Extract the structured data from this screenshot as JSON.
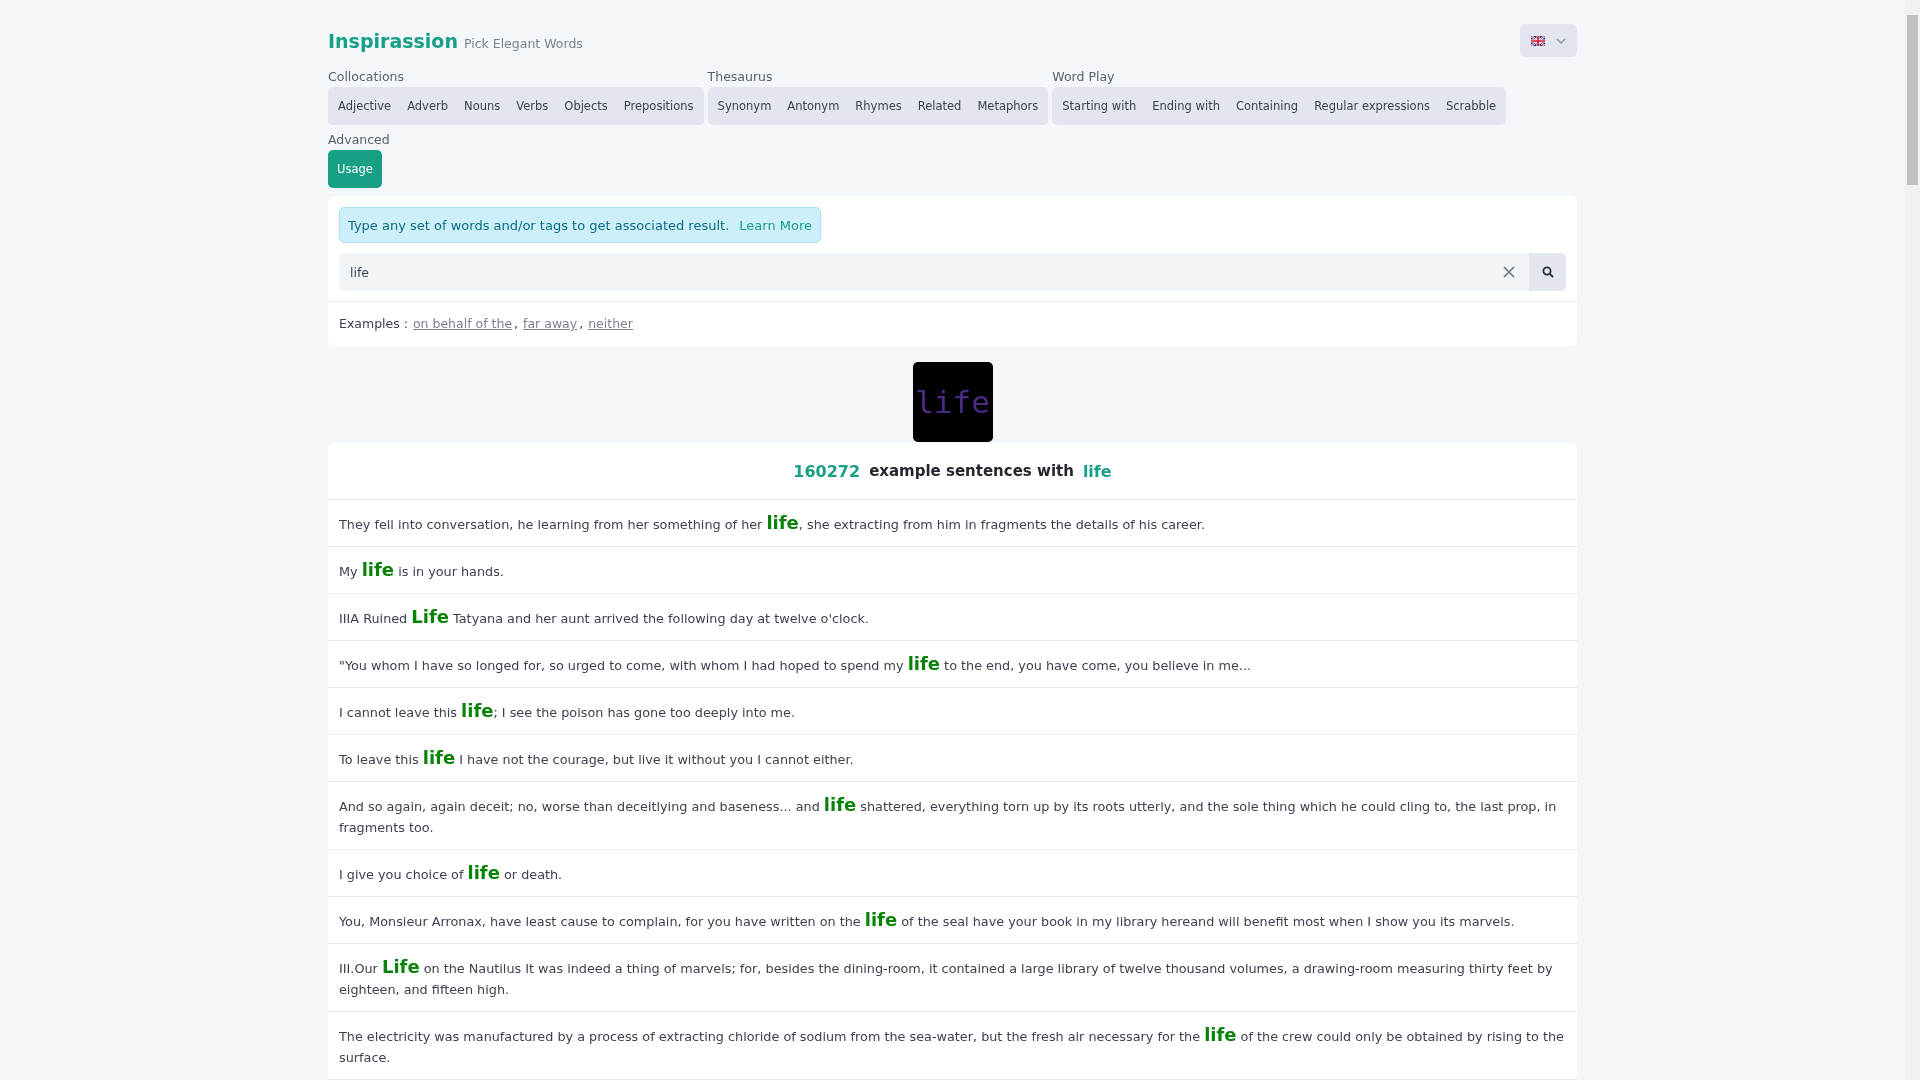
{
  "brand": {
    "name": "Inspirassion",
    "tagline": "Pick Elegant Words"
  },
  "language_button": {
    "kind": "flag"
  },
  "tab_groups": [
    {
      "label": "Collocations",
      "tabs": [
        {
          "label": "Adjective",
          "selected": false
        },
        {
          "label": "Adverb",
          "selected": false
        },
        {
          "label": "Nouns",
          "selected": false
        },
        {
          "label": "Verbs",
          "selected": false
        },
        {
          "label": "Objects",
          "selected": false
        },
        {
          "label": "Prepositions",
          "selected": false
        }
      ]
    },
    {
      "label": "Thesaurus",
      "tabs": [
        {
          "label": "Synonym",
          "selected": false
        },
        {
          "label": "Antonym",
          "selected": false
        },
        {
          "label": "Rhymes",
          "selected": false
        },
        {
          "label": "Related",
          "selected": false
        },
        {
          "label": "Metaphors",
          "selected": false
        }
      ]
    },
    {
      "label": "Word Play",
      "tabs": [
        {
          "label": "Starting with",
          "selected": false
        },
        {
          "label": "Ending with",
          "selected": false
        },
        {
          "label": "Containing",
          "selected": false
        },
        {
          "label": "Regular expressions",
          "selected": false
        },
        {
          "label": "Scrabble",
          "selected": false
        }
      ]
    },
    {
      "label": "Advanced",
      "tabs": [
        {
          "label": "Usage",
          "selected": true
        }
      ]
    }
  ],
  "info": {
    "text": "Type any set of words and/or tags to get associated result.",
    "link": "Learn More"
  },
  "search": {
    "value": "life"
  },
  "examples": {
    "label": "Examples :",
    "separator": ",",
    "links": [
      "on behalf of the",
      "far away",
      "neither"
    ]
  },
  "word_image": {
    "text": "life"
  },
  "results": {
    "count": "160272",
    "text": "example sentences with",
    "word": "life",
    "sentences": [
      "They fell into conversation, he learning from her something of her **life**, she extracting from him in fragments the details of his career.",
      "My **life** is in your hands.",
      "IIIA Ruined **Life** Tatyana and her aunt arrived the following day at twelve o'clock.",
      "\"You whom I have so longed for, so urged to come, with whom I had hoped to spend my **life** to the end, you have come, you believe in me...",
      "I cannot leave this **life**; I see the poison has gone too deeply into me.",
      "To leave this **life** I have not the courage, but live it without you I cannot either.",
      "And so again, again deceit; no, worse than deceitlying and baseness... and **life** shattered, everything torn up by its roots utterly, and the sole thing which he could cling to, the last prop, in fragments too.",
      "I give you choice of **life** or death.",
      "You, Monsieur Arronax, have least cause to complain, for you have written on the **life** of the seal have your book in my library hereand will benefit most when I show you its marvels.",
      "III.Our **Life** on the Nautilus It was indeed a thing of marvels; for, besides the dining-room, it contained a large library of twelve thousand volumes, a drawing-room measuring thirty feet by eighteen, and fifteen high.",
      "The electricity was manufactured by a process of extracting chloride of sodium from the sea-water, but the fresh air necessary for the **life** of the crew could only be obtained by rising to the surface."
    ]
  }
}
